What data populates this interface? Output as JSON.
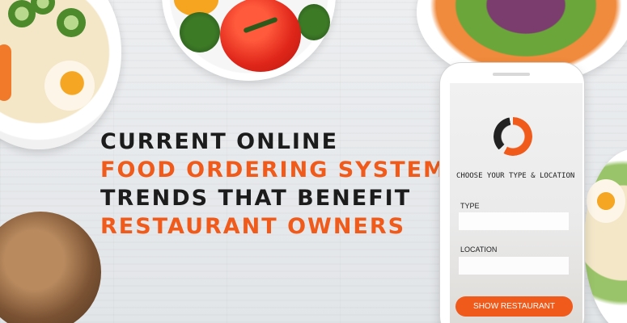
{
  "headline": {
    "line1": "CURRENT ONLINE",
    "line2": "FOOD ORDERING SYSTEM",
    "line3": "TRENDS THAT BENEFIT",
    "line4": "RESTAURANT OWNERS"
  },
  "phone": {
    "heading": "CHOOSE YOUR TYPE & LOCATION",
    "type_label": "TYPE",
    "type_value": "",
    "location_label": "LOCATION",
    "location_value": "",
    "button_label": "SHOW RESTAURANT"
  },
  "colors": {
    "accent": "#f05a1a",
    "dark_text": "#1c1c1c"
  },
  "icons": [
    "logo-ring-icon"
  ]
}
